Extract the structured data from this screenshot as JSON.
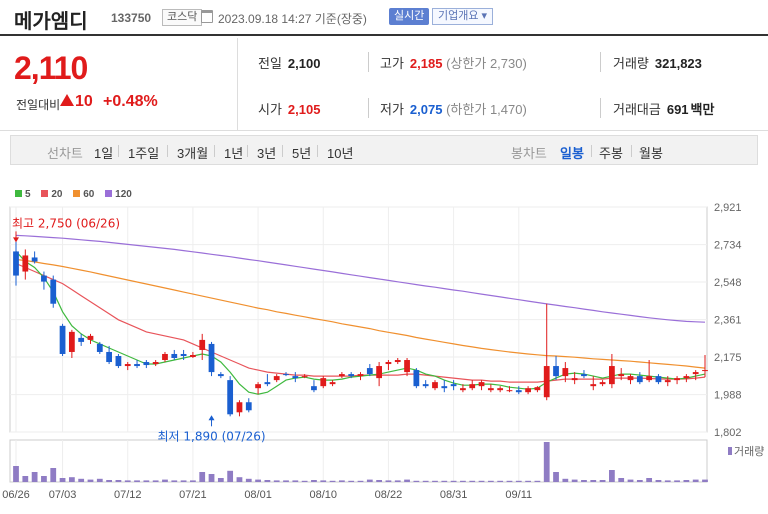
{
  "header": {
    "name": "메가엠디",
    "code": "133750",
    "market": "코스닥",
    "time": "2023.09.18 14:27 기준(장중)",
    "realtime": "실시간",
    "company_info": "기업개요 ▾"
  },
  "price": {
    "current": "2,110",
    "diff_label": "전일대비",
    "diff": "10",
    "pct": "+0.48%",
    "prev_label": "전일",
    "prev": "2,100",
    "high_label": "고가",
    "high": "2,185",
    "upper_label": "(상한가",
    "upper": "2,730)",
    "volume_label": "거래량",
    "volume": "321,823",
    "open_label": "시가",
    "open": "2,105",
    "low_label": "저가",
    "low": "2,075",
    "lower_label": "(하한가",
    "lower": "1,470)",
    "amount_label": "거래대금",
    "amount": "691",
    "amount_unit": "백만"
  },
  "period_bar": {
    "line_label": "선차트",
    "line_periods": [
      "1일",
      "1주일",
      "3개월",
      "1년",
      "3년",
      "5년",
      "10년"
    ],
    "candle_label": "봉차트",
    "candle_periods": [
      "일봉",
      "주봉",
      "월봉"
    ],
    "selected": "일봉"
  },
  "colors": {
    "up": "#e01b1b",
    "down": "#1a5fd0",
    "ma5": "#3fb93f",
    "ma20": "#e8545a",
    "ma60": "#f0902f",
    "ma120": "#9a6fd8"
  },
  "chart_data": {
    "type": "candlestick",
    "legend": [
      "5",
      "20",
      "60",
      "120"
    ],
    "y_ticks": [
      "2,921",
      "2,734",
      "2,548",
      "2,361",
      "2,175",
      "1,988",
      "1,802"
    ],
    "y_tick_values": [
      2921,
      2734,
      2548,
      2361,
      2175,
      1988,
      1802
    ],
    "ylim": [
      1802,
      2921
    ],
    "x_ticks": [
      "06/26",
      "07/03",
      "07/12",
      "07/21",
      "08/01",
      "08/10",
      "08/22",
      "08/31",
      "09/11"
    ],
    "x_tick_index": [
      0,
      5,
      12,
      19,
      26,
      33,
      40,
      47,
      54
    ],
    "high_note": "최고 2,750 (06/26)",
    "low_note": "최저 1,890 (07/26)",
    "high_index": 0,
    "high_value": 2750,
    "low_index": 21,
    "low_value": 1890,
    "volume_label": "거래량",
    "candles": [
      [
        2700,
        2750,
        2530,
        2580
      ],
      [
        2600,
        2710,
        2560,
        2680
      ],
      [
        2670,
        2700,
        2640,
        2650
      ],
      [
        2580,
        2600,
        2510,
        2550
      ],
      [
        2560,
        2580,
        2420,
        2440
      ],
      [
        2330,
        2340,
        2180,
        2190
      ],
      [
        2200,
        2310,
        2170,
        2300
      ],
      [
        2270,
        2290,
        2230,
        2250
      ],
      [
        2260,
        2290,
        2240,
        2280
      ],
      [
        2240,
        2250,
        2190,
        2200
      ],
      [
        2200,
        2230,
        2140,
        2150
      ],
      [
        2180,
        2190,
        2120,
        2130
      ],
      [
        2130,
        2150,
        2110,
        2140
      ],
      [
        2140,
        2160,
        2120,
        2130
      ],
      [
        2150,
        2160,
        2120,
        2135
      ],
      [
        2140,
        2160,
        2130,
        2150
      ],
      [
        2160,
        2200,
        2150,
        2190
      ],
      [
        2190,
        2210,
        2160,
        2170
      ],
      [
        2190,
        2210,
        2160,
        2180
      ],
      [
        2175,
        2200,
        2170,
        2185
      ],
      [
        2210,
        2290,
        2160,
        2260
      ],
      [
        2240,
        2250,
        2080,
        2100
      ],
      [
        2090,
        2100,
        2070,
        2080
      ],
      [
        2060,
        2080,
        1880,
        1890
      ],
      [
        1900,
        1960,
        1880,
        1950
      ],
      [
        1950,
        1970,
        1900,
        1910
      ],
      [
        2020,
        2050,
        1990,
        2040
      ],
      [
        2050,
        2090,
        2030,
        2040
      ],
      [
        2060,
        2090,
        2050,
        2080
      ],
      [
        2090,
        2100,
        2080,
        2085
      ],
      [
        2080,
        2100,
        2050,
        2070
      ],
      [
        2080,
        2090,
        2070,
        2080
      ],
      [
        2030,
        2060,
        2000,
        2010
      ],
      [
        2030,
        2080,
        2020,
        2070
      ],
      [
        2040,
        2060,
        2030,
        2050
      ],
      [
        2080,
        2100,
        2070,
        2090
      ],
      [
        2090,
        2100,
        2070,
        2080
      ],
      [
        2080,
        2100,
        2060,
        2090
      ],
      [
        2120,
        2140,
        2080,
        2090
      ],
      [
        2070,
        2150,
        2030,
        2130
      ],
      [
        2140,
        2160,
        2110,
        2150
      ],
      [
        2150,
        2170,
        2140,
        2160
      ],
      [
        2100,
        2170,
        2080,
        2160
      ],
      [
        2110,
        2120,
        2020,
        2030
      ],
      [
        2040,
        2060,
        2020,
        2030
      ],
      [
        2020,
        2060,
        2010,
        2050
      ],
      [
        2030,
        2060,
        2000,
        2020
      ],
      [
        2040,
        2060,
        2010,
        2030
      ],
      [
        2010,
        2040,
        2000,
        2020
      ],
      [
        2020,
        2060,
        2010,
        2040
      ],
      [
        2030,
        2060,
        2010,
        2050
      ],
      [
        2010,
        2040,
        2000,
        2020
      ],
      [
        2010,
        2030,
        2000,
        2020
      ],
      [
        2010,
        2030,
        2000,
        2010
      ],
      [
        2010,
        2030,
        1990,
        2000
      ],
      [
        2000,
        2030,
        1990,
        2020
      ],
      [
        2010,
        2030,
        2000,
        2025
      ],
      [
        1975,
        2440,
        1960,
        2130
      ],
      [
        2130,
        2180,
        2060,
        2080
      ],
      [
        2080,
        2150,
        2050,
        2120
      ],
      [
        2060,
        2100,
        2040,
        2070
      ],
      [
        2090,
        2110,
        2070,
        2080
      ],
      [
        2030,
        2080,
        2010,
        2040
      ],
      [
        2040,
        2060,
        2030,
        2050
      ],
      [
        2040,
        2190,
        2020,
        2130
      ],
      [
        2080,
        2120,
        2060,
        2090
      ],
      [
        2060,
        2090,
        2040,
        2080
      ],
      [
        2080,
        2100,
        2040,
        2050
      ],
      [
        2060,
        2160,
        2050,
        2080
      ],
      [
        2080,
        2090,
        2040,
        2050
      ],
      [
        2050,
        2080,
        2030,
        2060
      ],
      [
        2060,
        2080,
        2040,
        2070
      ],
      [
        2070,
        2090,
        2050,
        2080
      ],
      [
        2090,
        2110,
        2060,
        2100
      ],
      [
        2105,
        2185,
        2075,
        2110
      ]
    ],
    "ma5": [
      2700,
      2650,
      2620,
      2570,
      2500,
      2400,
      2330,
      2290,
      2260,
      2240,
      2220,
      2200,
      2180,
      2160,
      2140,
      2140,
      2150,
      2160,
      2170,
      2180,
      2190,
      2180,
      2150,
      2100,
      2040,
      2000,
      1990,
      2000,
      2030,
      2060,
      2070,
      2075,
      2065,
      2060,
      2060,
      2065,
      2075,
      2080,
      2085,
      2090,
      2100,
      2110,
      2120,
      2110,
      2090,
      2080,
      2060,
      2045,
      2035,
      2035,
      2040,
      2040,
      2035,
      2025,
      2020,
      2015,
      2020,
      2050,
      2070,
      2090,
      2095,
      2090,
      2080,
      2070,
      2080,
      2090,
      2090,
      2085,
      2080,
      2075,
      2070,
      2065,
      2070,
      2080,
      2090
    ],
    "ma20": [
      2640,
      2620,
      2600,
      2580,
      2560,
      2540,
      2510,
      2480,
      2450,
      2420,
      2390,
      2360,
      2340,
      2320,
      2300,
      2290,
      2280,
      2270,
      2260,
      2240,
      2220,
      2200,
      2180,
      2160,
      2140,
      2120,
      2110,
      2100,
      2095,
      2090,
      2085,
      2085,
      2080,
      2080,
      2080,
      2080,
      2080,
      2085,
      2085,
      2085,
      2085,
      2085,
      2090,
      2090,
      2085,
      2080,
      2075,
      2070,
      2065,
      2060,
      2060,
      2055,
      2055,
      2050,
      2050,
      2050,
      2050,
      2055,
      2060,
      2065,
      2065,
      2065,
      2065,
      2065,
      2070,
      2070,
      2070,
      2070,
      2068,
      2066,
      2065,
      2065,
      2066,
      2070,
      2075
    ],
    "ma60": [
      2660,
      2655,
      2648,
      2640,
      2633,
      2625,
      2616,
      2607,
      2598,
      2588,
      2578,
      2568,
      2558,
      2548,
      2538,
      2528,
      2518,
      2508,
      2498,
      2488,
      2478,
      2468,
      2458,
      2448,
      2438,
      2428,
      2418,
      2410,
      2400,
      2392,
      2383,
      2375,
      2366,
      2358,
      2350,
      2340,
      2332,
      2324,
      2316,
      2306,
      2298,
      2290,
      2282,
      2272,
      2264,
      2256,
      2248,
      2240,
      2232,
      2225,
      2218,
      2212,
      2206,
      2200,
      2195,
      2190,
      2186,
      2182,
      2180,
      2177,
      2174,
      2170,
      2166,
      2163,
      2160,
      2157,
      2154,
      2150,
      2146,
      2142,
      2138,
      2134,
      2130,
      2125,
      2120
    ],
    "ma120": [
      2780,
      2778,
      2775,
      2772,
      2769,
      2766,
      2762,
      2758,
      2754,
      2750,
      2745,
      2740,
      2735,
      2730,
      2725,
      2720,
      2715,
      2710,
      2704,
      2698,
      2692,
      2686,
      2680,
      2674,
      2667,
      2660,
      2654,
      2647,
      2640,
      2633,
      2626,
      2619,
      2612,
      2605,
      2598,
      2591,
      2584,
      2577,
      2570,
      2563,
      2556,
      2549,
      2542,
      2535,
      2528,
      2522,
      2515,
      2508,
      2502,
      2495,
      2488,
      2481,
      2474,
      2467,
      2460,
      2453,
      2446,
      2439,
      2433,
      2426,
      2420,
      2413,
      2407,
      2400,
      2394,
      2388,
      2382,
      2376,
      2370,
      2365,
      2360,
      2356,
      2352,
      2350,
      2348
    ],
    "volume": [
      40,
      15,
      25,
      15,
      35,
      10,
      12,
      8,
      6,
      8,
      5,
      5,
      4,
      4,
      4,
      4,
      6,
      4,
      4,
      4,
      25,
      20,
      10,
      28,
      12,
      8,
      6,
      5,
      4,
      4,
      4,
      3,
      5,
      4,
      3,
      4,
      3,
      3,
      6,
      5,
      4,
      4,
      6,
      3,
      3,
      3,
      3,
      3,
      3,
      3,
      3,
      3,
      3,
      3,
      3,
      3,
      3,
      100,
      25,
      8,
      6,
      5,
      5,
      5,
      30,
      10,
      6,
      5,
      10,
      5,
      4,
      4,
      5,
      6,
      6
    ]
  }
}
